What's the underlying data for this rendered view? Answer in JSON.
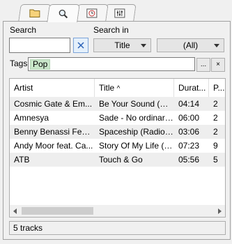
{
  "tabs": [
    {
      "icon": "folder-icon"
    },
    {
      "icon": "search-icon"
    },
    {
      "icon": "clock-icon"
    },
    {
      "icon": "equalizer-icon"
    }
  ],
  "search": {
    "label": "Search",
    "value": "",
    "clear_icon": "close-icon"
  },
  "search_in": {
    "label": "Search in",
    "field_value": "Title",
    "scope_value": "(All)"
  },
  "tags": {
    "label": "Tags",
    "chip": "Pop",
    "more_label": "...",
    "clear_label": "×"
  },
  "table": {
    "columns": [
      "Artist",
      "Title",
      "Durat...",
      "P..."
    ],
    "sort_indicator": "^",
    "rows": [
      [
        "Cosmic Gate & Em...",
        "Be Your Sound (Ra...",
        "04:14",
        "2"
      ],
      [
        "Amnesya",
        "Sade - No ordinary...",
        "06:00",
        "2"
      ],
      [
        "Benny Benassi Feat ...",
        "Spaceship (Radio e...",
        "03:06",
        "2"
      ],
      [
        "Andy Moor feat. Ca...",
        "Story Of My Life (E...",
        "07:23",
        "9"
      ],
      [
        "ATB",
        "Touch & Go",
        "05:56",
        "5"
      ]
    ]
  },
  "status": {
    "text": "5 tracks"
  },
  "colors": {
    "tag_chip": "#c8e6c9",
    "clear_button": "#e5f0fb",
    "row_alt": "#eeeeee"
  }
}
